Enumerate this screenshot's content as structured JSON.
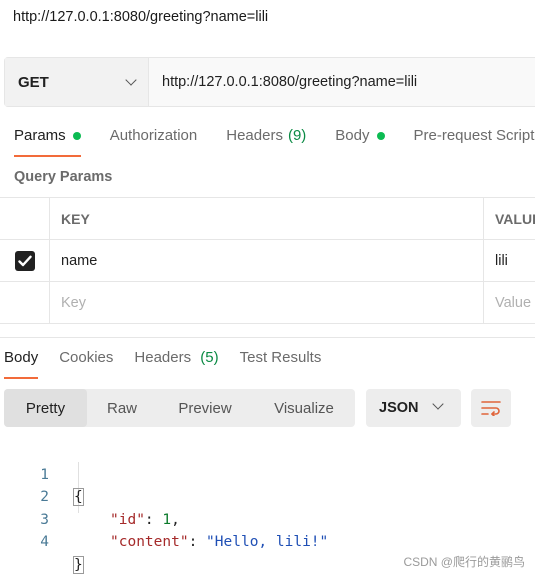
{
  "title_url": "http://127.0.0.1:8080/greeting?name=lili",
  "request": {
    "method": "GET",
    "url": "http://127.0.0.1:8080/greeting?name=lili"
  },
  "request_tabs": [
    {
      "label": "Params"
    },
    {
      "label": "Authorization"
    },
    {
      "label": "Headers",
      "count": "(9)"
    },
    {
      "label": "Body"
    },
    {
      "label": "Pre-request Script"
    }
  ],
  "query_params": {
    "label": "Query Params",
    "headers": {
      "key": "KEY",
      "value": "VALUE"
    },
    "rows": [
      {
        "checked": true,
        "key": "name",
        "value": "lili"
      }
    ],
    "placeholders": {
      "key": "Key",
      "value": "Value"
    }
  },
  "response_tabs": [
    {
      "label": "Body"
    },
    {
      "label": "Cookies"
    },
    {
      "label": "Headers",
      "count": "(5)"
    },
    {
      "label": "Test Results"
    }
  ],
  "view_modes": [
    "Pretty",
    "Raw",
    "Preview",
    "Visualize"
  ],
  "active_view": "Pretty",
  "format": "JSON",
  "response_lines": [
    {
      "n": "1",
      "open": "{"
    },
    {
      "n": "2",
      "key": "\"id\"",
      "sep": ": ",
      "value": "1",
      "end": ","
    },
    {
      "n": "3",
      "key": "\"content\"",
      "sep": ": ",
      "value": "\"Hello, lili!\""
    },
    {
      "n": "4",
      "close": "}"
    }
  ],
  "watermark": "CSDN @爬行的黄鹂鸟",
  "colors": {
    "accent": "#f26b3a",
    "green_dot": "#0cbb52"
  }
}
